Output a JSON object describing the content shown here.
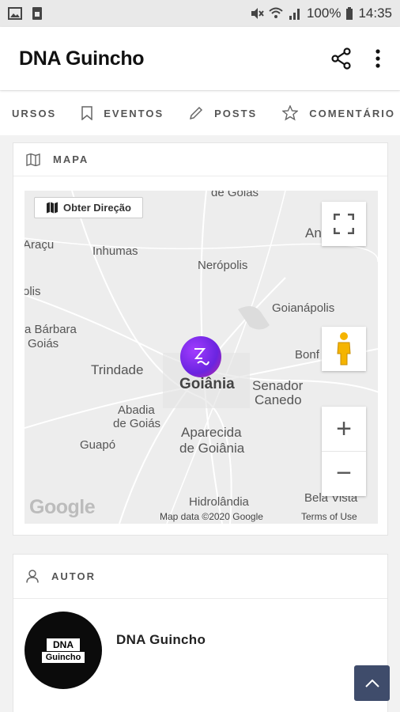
{
  "status": {
    "battery": "100%",
    "time": "14:35"
  },
  "appbar": {
    "title": "DNA Guincho"
  },
  "tabs": [
    {
      "label": "URSOS",
      "icon": "none"
    },
    {
      "label": "EVENTOS",
      "icon": "bookmark-icon"
    },
    {
      "label": "POSTS",
      "icon": "pencil-icon"
    },
    {
      "label": "COMENTÁRIO",
      "icon": "star-icon"
    }
  ],
  "map_section": {
    "header": "MAPA",
    "directions_label": "Obter Direção",
    "places": {
      "goias_top": "de Goiás",
      "aracu": "Araçu",
      "inhumas": "Inhumas",
      "neropolis": "Nerópolis",
      "an": "An",
      "olis": "olis",
      "goianapolis": "Goianápolis",
      "barbara": "a Bárbara",
      "goias": "Goiás",
      "bonf": "Bonf",
      "trindade": "Trindade",
      "goiania": "Goiânia",
      "senador": "Senador",
      "canedo": "Canedo",
      "abadia": "Abadia",
      "de_goias": "de Goiás",
      "aparecida": "Aparecida",
      "de_goiania": "de Goiânia",
      "guapo": "Guapó",
      "hidrolandia": "Hidrolândia",
      "bela_vista": "Bela Vista"
    },
    "google_logo": "Google",
    "attribution": "Map data ©2020 Google",
    "terms": "Terms of Use",
    "zoom_in": "+",
    "zoom_out": "−"
  },
  "author_section": {
    "header": "AUTOR",
    "name": "DNA Guincho",
    "logo_line1": "DNA",
    "logo_line2": "Guincho"
  },
  "colors": {
    "accent": "#3f4c6b",
    "marker": "#7b2ff7"
  }
}
